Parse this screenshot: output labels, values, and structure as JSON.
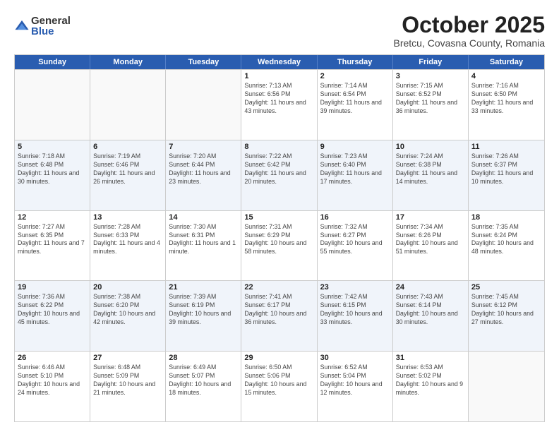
{
  "logo": {
    "general": "General",
    "blue": "Blue"
  },
  "title": "October 2025",
  "subtitle": "Bretcu, Covasna County, Romania",
  "weekdays": [
    "Sunday",
    "Monday",
    "Tuesday",
    "Wednesday",
    "Thursday",
    "Friday",
    "Saturday"
  ],
  "rows": [
    [
      {
        "day": "",
        "info": ""
      },
      {
        "day": "",
        "info": ""
      },
      {
        "day": "",
        "info": ""
      },
      {
        "day": "1",
        "info": "Sunrise: 7:13 AM\nSunset: 6:56 PM\nDaylight: 11 hours and 43 minutes."
      },
      {
        "day": "2",
        "info": "Sunrise: 7:14 AM\nSunset: 6:54 PM\nDaylight: 11 hours and 39 minutes."
      },
      {
        "day": "3",
        "info": "Sunrise: 7:15 AM\nSunset: 6:52 PM\nDaylight: 11 hours and 36 minutes."
      },
      {
        "day": "4",
        "info": "Sunrise: 7:16 AM\nSunset: 6:50 PM\nDaylight: 11 hours and 33 minutes."
      }
    ],
    [
      {
        "day": "5",
        "info": "Sunrise: 7:18 AM\nSunset: 6:48 PM\nDaylight: 11 hours and 30 minutes."
      },
      {
        "day": "6",
        "info": "Sunrise: 7:19 AM\nSunset: 6:46 PM\nDaylight: 11 hours and 26 minutes."
      },
      {
        "day": "7",
        "info": "Sunrise: 7:20 AM\nSunset: 6:44 PM\nDaylight: 11 hours and 23 minutes."
      },
      {
        "day": "8",
        "info": "Sunrise: 7:22 AM\nSunset: 6:42 PM\nDaylight: 11 hours and 20 minutes."
      },
      {
        "day": "9",
        "info": "Sunrise: 7:23 AM\nSunset: 6:40 PM\nDaylight: 11 hours and 17 minutes."
      },
      {
        "day": "10",
        "info": "Sunrise: 7:24 AM\nSunset: 6:38 PM\nDaylight: 11 hours and 14 minutes."
      },
      {
        "day": "11",
        "info": "Sunrise: 7:26 AM\nSunset: 6:37 PM\nDaylight: 11 hours and 10 minutes."
      }
    ],
    [
      {
        "day": "12",
        "info": "Sunrise: 7:27 AM\nSunset: 6:35 PM\nDaylight: 11 hours and 7 minutes."
      },
      {
        "day": "13",
        "info": "Sunrise: 7:28 AM\nSunset: 6:33 PM\nDaylight: 11 hours and 4 minutes."
      },
      {
        "day": "14",
        "info": "Sunrise: 7:30 AM\nSunset: 6:31 PM\nDaylight: 11 hours and 1 minute."
      },
      {
        "day": "15",
        "info": "Sunrise: 7:31 AM\nSunset: 6:29 PM\nDaylight: 10 hours and 58 minutes."
      },
      {
        "day": "16",
        "info": "Sunrise: 7:32 AM\nSunset: 6:27 PM\nDaylight: 10 hours and 55 minutes."
      },
      {
        "day": "17",
        "info": "Sunrise: 7:34 AM\nSunset: 6:26 PM\nDaylight: 10 hours and 51 minutes."
      },
      {
        "day": "18",
        "info": "Sunrise: 7:35 AM\nSunset: 6:24 PM\nDaylight: 10 hours and 48 minutes."
      }
    ],
    [
      {
        "day": "19",
        "info": "Sunrise: 7:36 AM\nSunset: 6:22 PM\nDaylight: 10 hours and 45 minutes."
      },
      {
        "day": "20",
        "info": "Sunrise: 7:38 AM\nSunset: 6:20 PM\nDaylight: 10 hours and 42 minutes."
      },
      {
        "day": "21",
        "info": "Sunrise: 7:39 AM\nSunset: 6:19 PM\nDaylight: 10 hours and 39 minutes."
      },
      {
        "day": "22",
        "info": "Sunrise: 7:41 AM\nSunset: 6:17 PM\nDaylight: 10 hours and 36 minutes."
      },
      {
        "day": "23",
        "info": "Sunrise: 7:42 AM\nSunset: 6:15 PM\nDaylight: 10 hours and 33 minutes."
      },
      {
        "day": "24",
        "info": "Sunrise: 7:43 AM\nSunset: 6:14 PM\nDaylight: 10 hours and 30 minutes."
      },
      {
        "day": "25",
        "info": "Sunrise: 7:45 AM\nSunset: 6:12 PM\nDaylight: 10 hours and 27 minutes."
      }
    ],
    [
      {
        "day": "26",
        "info": "Sunrise: 6:46 AM\nSunset: 5:10 PM\nDaylight: 10 hours and 24 minutes."
      },
      {
        "day": "27",
        "info": "Sunrise: 6:48 AM\nSunset: 5:09 PM\nDaylight: 10 hours and 21 minutes."
      },
      {
        "day": "28",
        "info": "Sunrise: 6:49 AM\nSunset: 5:07 PM\nDaylight: 10 hours and 18 minutes."
      },
      {
        "day": "29",
        "info": "Sunrise: 6:50 AM\nSunset: 5:06 PM\nDaylight: 10 hours and 15 minutes."
      },
      {
        "day": "30",
        "info": "Sunrise: 6:52 AM\nSunset: 5:04 PM\nDaylight: 10 hours and 12 minutes."
      },
      {
        "day": "31",
        "info": "Sunrise: 6:53 AM\nSunset: 5:02 PM\nDaylight: 10 hours and 9 minutes."
      },
      {
        "day": "",
        "info": ""
      }
    ]
  ]
}
